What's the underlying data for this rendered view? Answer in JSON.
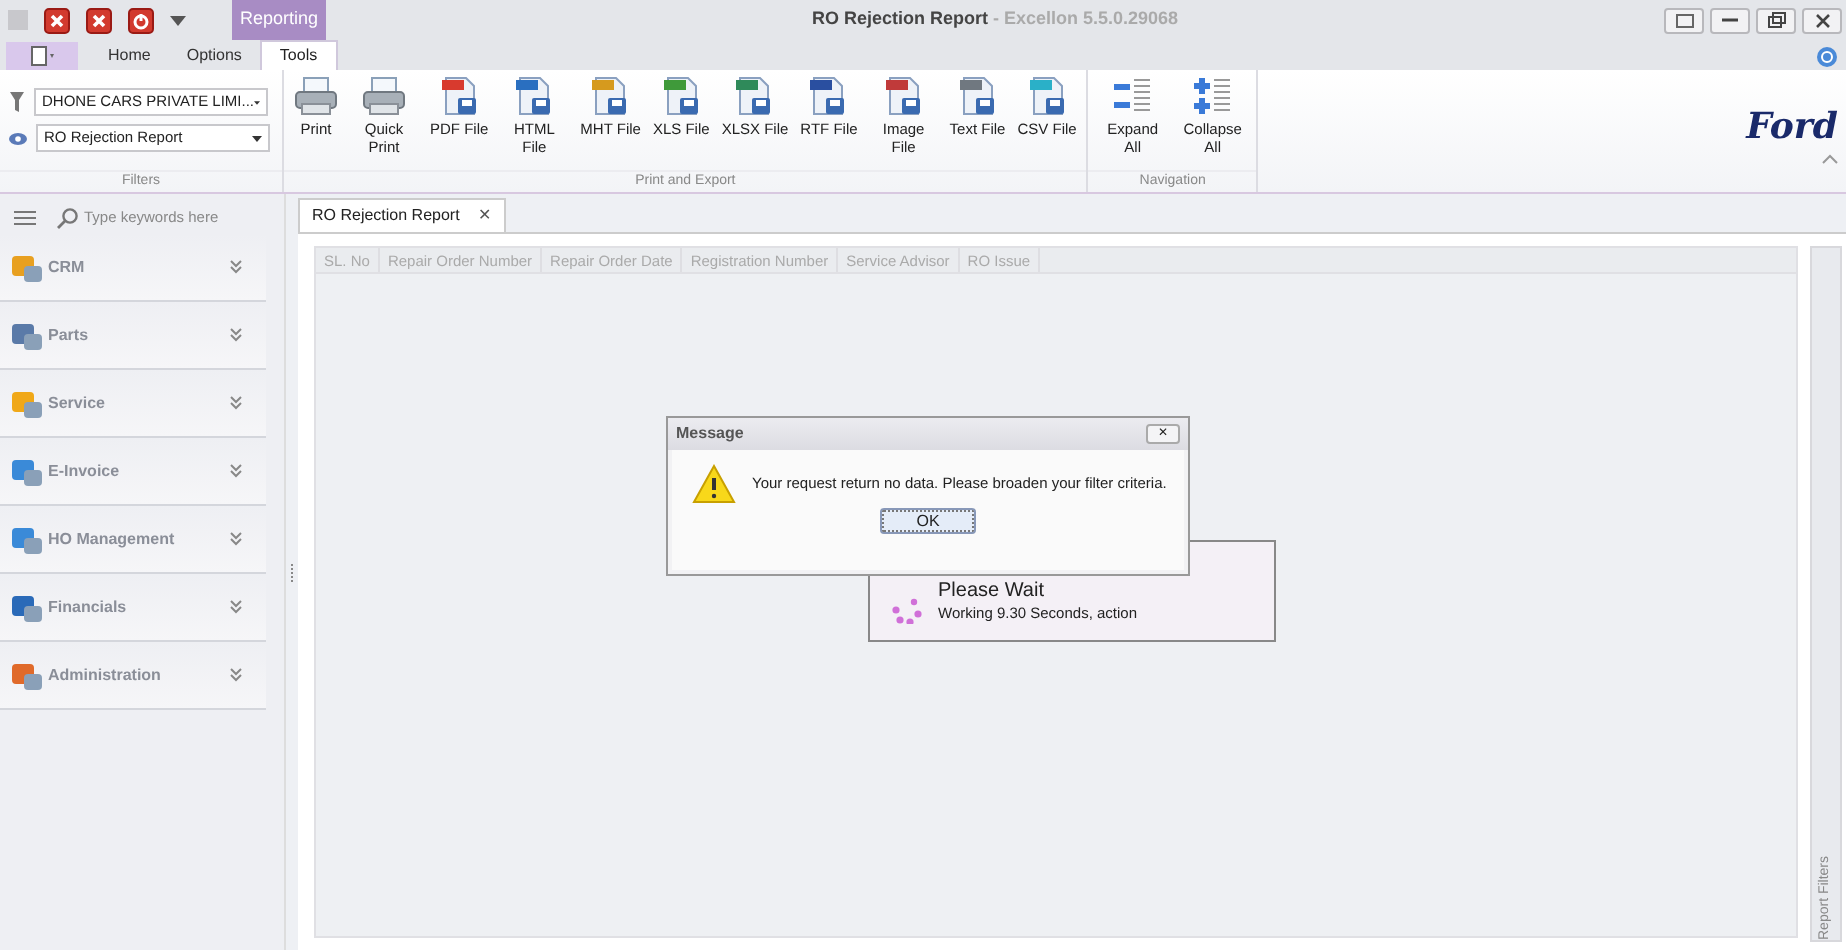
{
  "window": {
    "title": "RO Rejection Report",
    "version": " - Excellon 5.5.0.29068",
    "context_tab": "Reporting"
  },
  "ribbon_tabs": [
    {
      "label": "Home",
      "selected": false
    },
    {
      "label": "Options",
      "selected": false
    },
    {
      "label": "Tools",
      "selected": true
    }
  ],
  "filters": {
    "caption": "Filters",
    "combos": [
      {
        "kind": "company",
        "value": "DHONE CARS PRIVATE LIMI..."
      },
      {
        "kind": "report",
        "value": "RO Rejection Report"
      }
    ]
  },
  "groups": [
    {
      "caption": "Print and Export",
      "buttons": [
        {
          "kind": "printer",
          "label": "Print"
        },
        {
          "kind": "printer",
          "label": "Quick Print"
        },
        {
          "kind": "file",
          "label": "PDF File",
          "color": "#d83a2e"
        },
        {
          "kind": "file",
          "label": "HTML File",
          "color": "#2a6fc0"
        },
        {
          "kind": "file",
          "label": "MHT File",
          "color": "#d69a1e"
        },
        {
          "kind": "file",
          "label": "XLS File",
          "color": "#3f9a3a"
        },
        {
          "kind": "file",
          "label": "XLSX File",
          "color": "#2f8a5a"
        },
        {
          "kind": "file",
          "label": "RTF File",
          "color": "#2a4fa0"
        },
        {
          "kind": "file",
          "label": "Image File",
          "color": "#c03a3a"
        },
        {
          "kind": "file",
          "label": "Text File",
          "color": "#707880"
        },
        {
          "kind": "file",
          "label": "CSV File",
          "color": "#2ab0c8"
        }
      ]
    },
    {
      "caption": "Navigation",
      "buttons": [
        {
          "kind": "expand",
          "label": "Expand All"
        },
        {
          "kind": "collapse",
          "label": "Collapse All"
        }
      ]
    }
  ],
  "brand": "Ford",
  "sidebar": {
    "search_placeholder": "Type keywords here",
    "items": [
      {
        "label": "CRM",
        "color": "#e8a020"
      },
      {
        "label": "Parts",
        "color": "#5a7aa8"
      },
      {
        "label": "Service",
        "color": "#f0a818"
      },
      {
        "label": "E-Invoice",
        "color": "#3a8ad8"
      },
      {
        "label": "HO Management",
        "color": "#3a8ad8"
      },
      {
        "label": "Financials",
        "color": "#2a6ab8"
      },
      {
        "label": "Administration",
        "color": "#e06a2a"
      }
    ]
  },
  "document_tab": {
    "title": "RO Rejection Report",
    "close": "✕"
  },
  "table": {
    "columns": [
      "SL. No",
      "Repair Order Number",
      "Repair Order Date",
      "Registration Number",
      "Service Advisor",
      "RO Issue"
    ]
  },
  "side_panel": {
    "label": "Report Filters"
  },
  "please_wait": {
    "title": "Please Wait",
    "detail": "Working 9.30 Seconds, action"
  },
  "message": {
    "title": "Message",
    "close": "✕",
    "text": "Your request return no data. Please broaden your filter criteria.",
    "button": "OK"
  }
}
